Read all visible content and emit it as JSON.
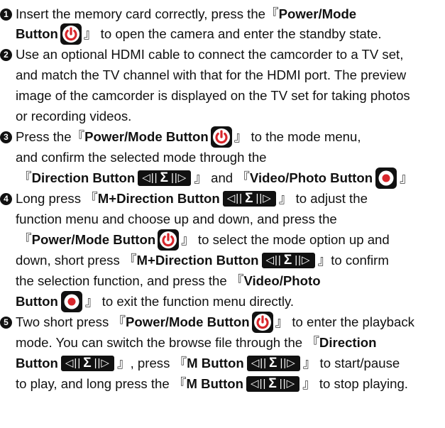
{
  "bullets": [
    "1",
    "2",
    "3",
    "4",
    "5"
  ],
  "dir_icon": {
    "left": "◁||",
    "sig": "Σ",
    "right": "||▷"
  },
  "lines": {
    "l1a": " Insert the memory card correctly, press the ",
    "l1b": "『",
    "l1c": "Power/Mode",
    "l2a": "Button",
    "l2b": "』 to open the camera and enter the standby state.",
    "l3a": " Use an optional HDMI cable to connect the camcorder to a TV set,",
    "l4a": "and match the TV channel with that for the HDMI port. The preview",
    "l5a": "image of the camcorder is displayed on the TV set for taking photos",
    "l6a": "or recording videos.",
    "l7a": " Press the ",
    "l7b": "『",
    "l7c": "Power/Mode Button",
    "l7d": "』 to the mode menu,",
    "l8a": "and confirm the selected mode through the",
    "l9a": "『",
    "l9b": "Direction Button",
    "l9c": "』 and 『",
    "l9d": "Video/Photo Button",
    "l9e": "』",
    "l10a": " Long press 『",
    "l10b": "M+Direction Button",
    "l10c": "』 to adjust the",
    "l11a": "function menu and choose up and down, and press the",
    "l12a": "『",
    "l12b": "Power/Mode Button",
    "l12c": "』 to select the mode option up and",
    "l13a": "down, short press 『",
    "l13b": "M+Direction Button",
    "l13c": "』to confirm",
    "l14a": "the selection function, and press the 『",
    "l14b": "Video/Photo",
    "l15a": "Button",
    "l15b": "』 to exit the function menu directly.",
    "l16a": " Two short press 『",
    "l16b": "Power/Mode Button",
    "l16c": "』 to enter the playback",
    "l17a": "mode. You can switch the browse file through the 『",
    "l17b": "Direction",
    "l18a": "Button",
    "l18b": "』, press  『",
    "l18c": "M Button",
    "l18d": "』 to start/pause",
    "l19a": "to play, and long press the 『",
    "l19b": "M Button",
    "l19c": "』 to stop playing."
  }
}
